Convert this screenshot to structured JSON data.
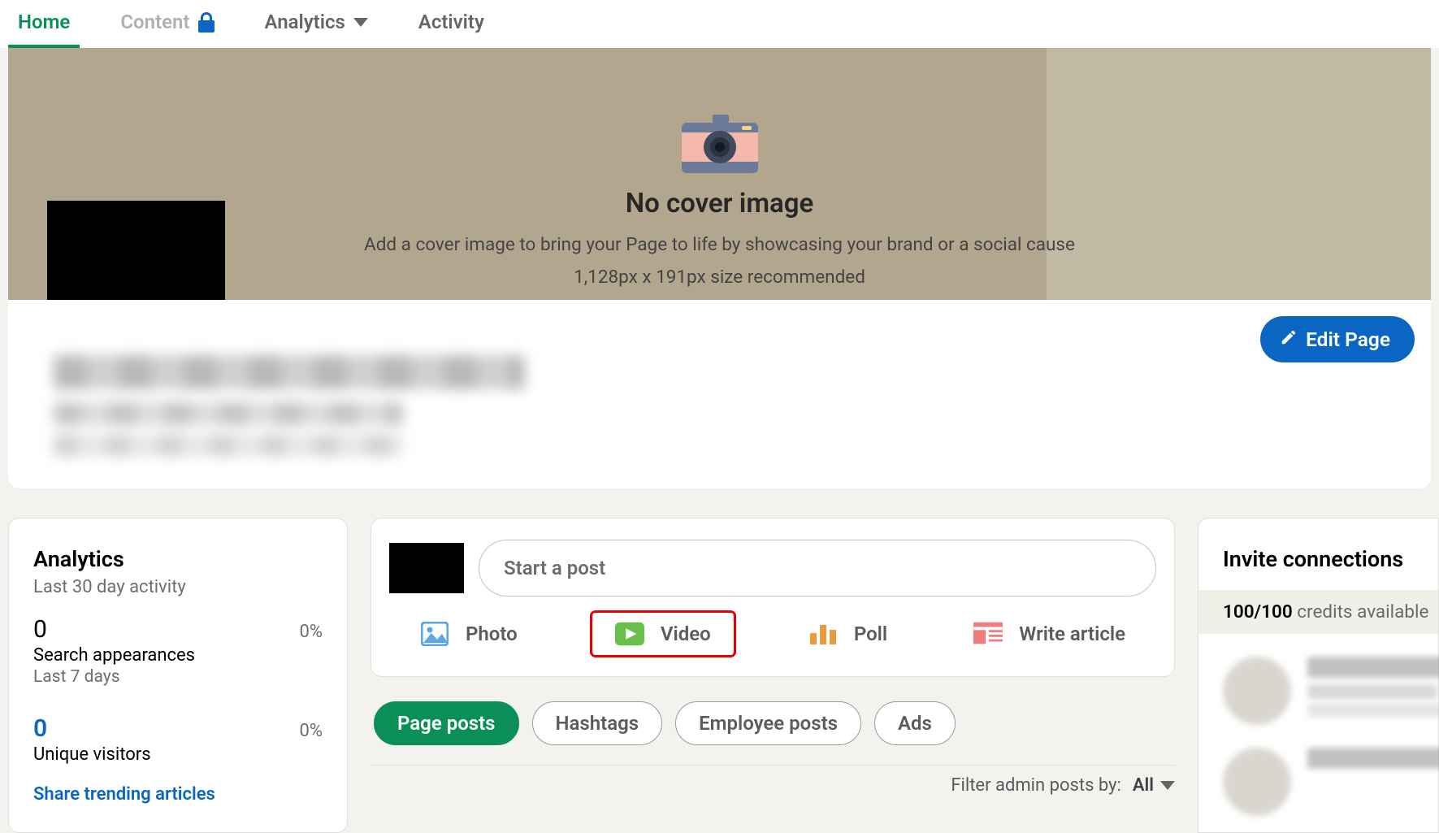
{
  "nav": {
    "tabs": [
      {
        "label": "Home",
        "active": true,
        "locked": false
      },
      {
        "label": "Content",
        "active": false,
        "locked": true
      },
      {
        "label": "Analytics",
        "active": false,
        "locked": false,
        "dropdown": true
      },
      {
        "label": "Activity",
        "active": false,
        "locked": false
      }
    ]
  },
  "cover": {
    "title": "No cover image",
    "subtitle": "Add a cover image to bring your Page to life by showcasing your brand or a social cause",
    "size_hint": "1,128px x 191px size recommended"
  },
  "header": {
    "edit_label": "Edit Page"
  },
  "analytics_card": {
    "title": "Analytics",
    "subtitle": "Last 30 day activity",
    "metrics": [
      {
        "value": "0",
        "pct": "0%",
        "label": "Search appearances",
        "period": "Last 7 days",
        "link": false
      },
      {
        "value": "0",
        "pct": "0%",
        "label": "Unique visitors",
        "period": "",
        "link": true
      }
    ],
    "share_link": "Share trending articles"
  },
  "composer": {
    "placeholder": "Start a post",
    "actions": [
      {
        "label": "Photo",
        "icon": "photo-icon"
      },
      {
        "label": "Video",
        "icon": "video-icon",
        "highlight": true
      },
      {
        "label": "Poll",
        "icon": "poll-icon"
      },
      {
        "label": "Write article",
        "icon": "article-icon"
      }
    ]
  },
  "post_tabs": [
    {
      "label": "Page posts",
      "active": true
    },
    {
      "label": "Hashtags",
      "active": false
    },
    {
      "label": "Employee posts",
      "active": false
    },
    {
      "label": "Ads",
      "active": false
    }
  ],
  "admin_filter": {
    "label": "Filter admin posts by:",
    "value": "All"
  },
  "invite": {
    "title": "Invite connections",
    "credits_num": "100/100",
    "credits_text": "credits available"
  }
}
